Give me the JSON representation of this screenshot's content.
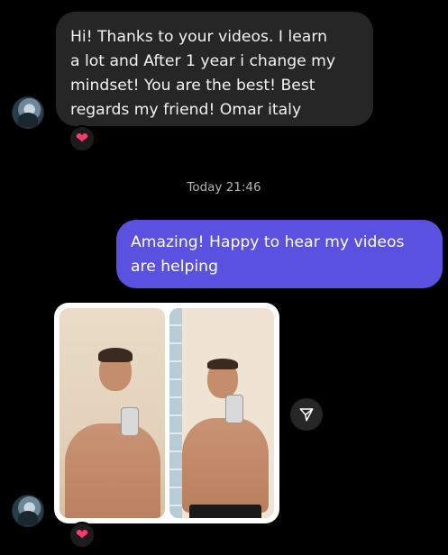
{
  "incoming_message": {
    "lines": [
      "Hi! Thanks to  your videos. I learn",
      "a lot and After 1 year i change my",
      "mindset! You are the best! Best",
      "regards my friend! Omar italy"
    ],
    "reaction_icon": "heart-icon"
  },
  "timestamp": "Today 21:46",
  "outgoing_message": {
    "lines": [
      "Amazing! Happy to hear my videos",
      "are helping"
    ]
  },
  "photo_message": {
    "reaction_icon": "heart-icon"
  },
  "colors": {
    "background": "#000000",
    "incoming_bubble": "#262626",
    "outgoing_bubble": "#5b51e0",
    "heart": "#ff3b6b"
  }
}
